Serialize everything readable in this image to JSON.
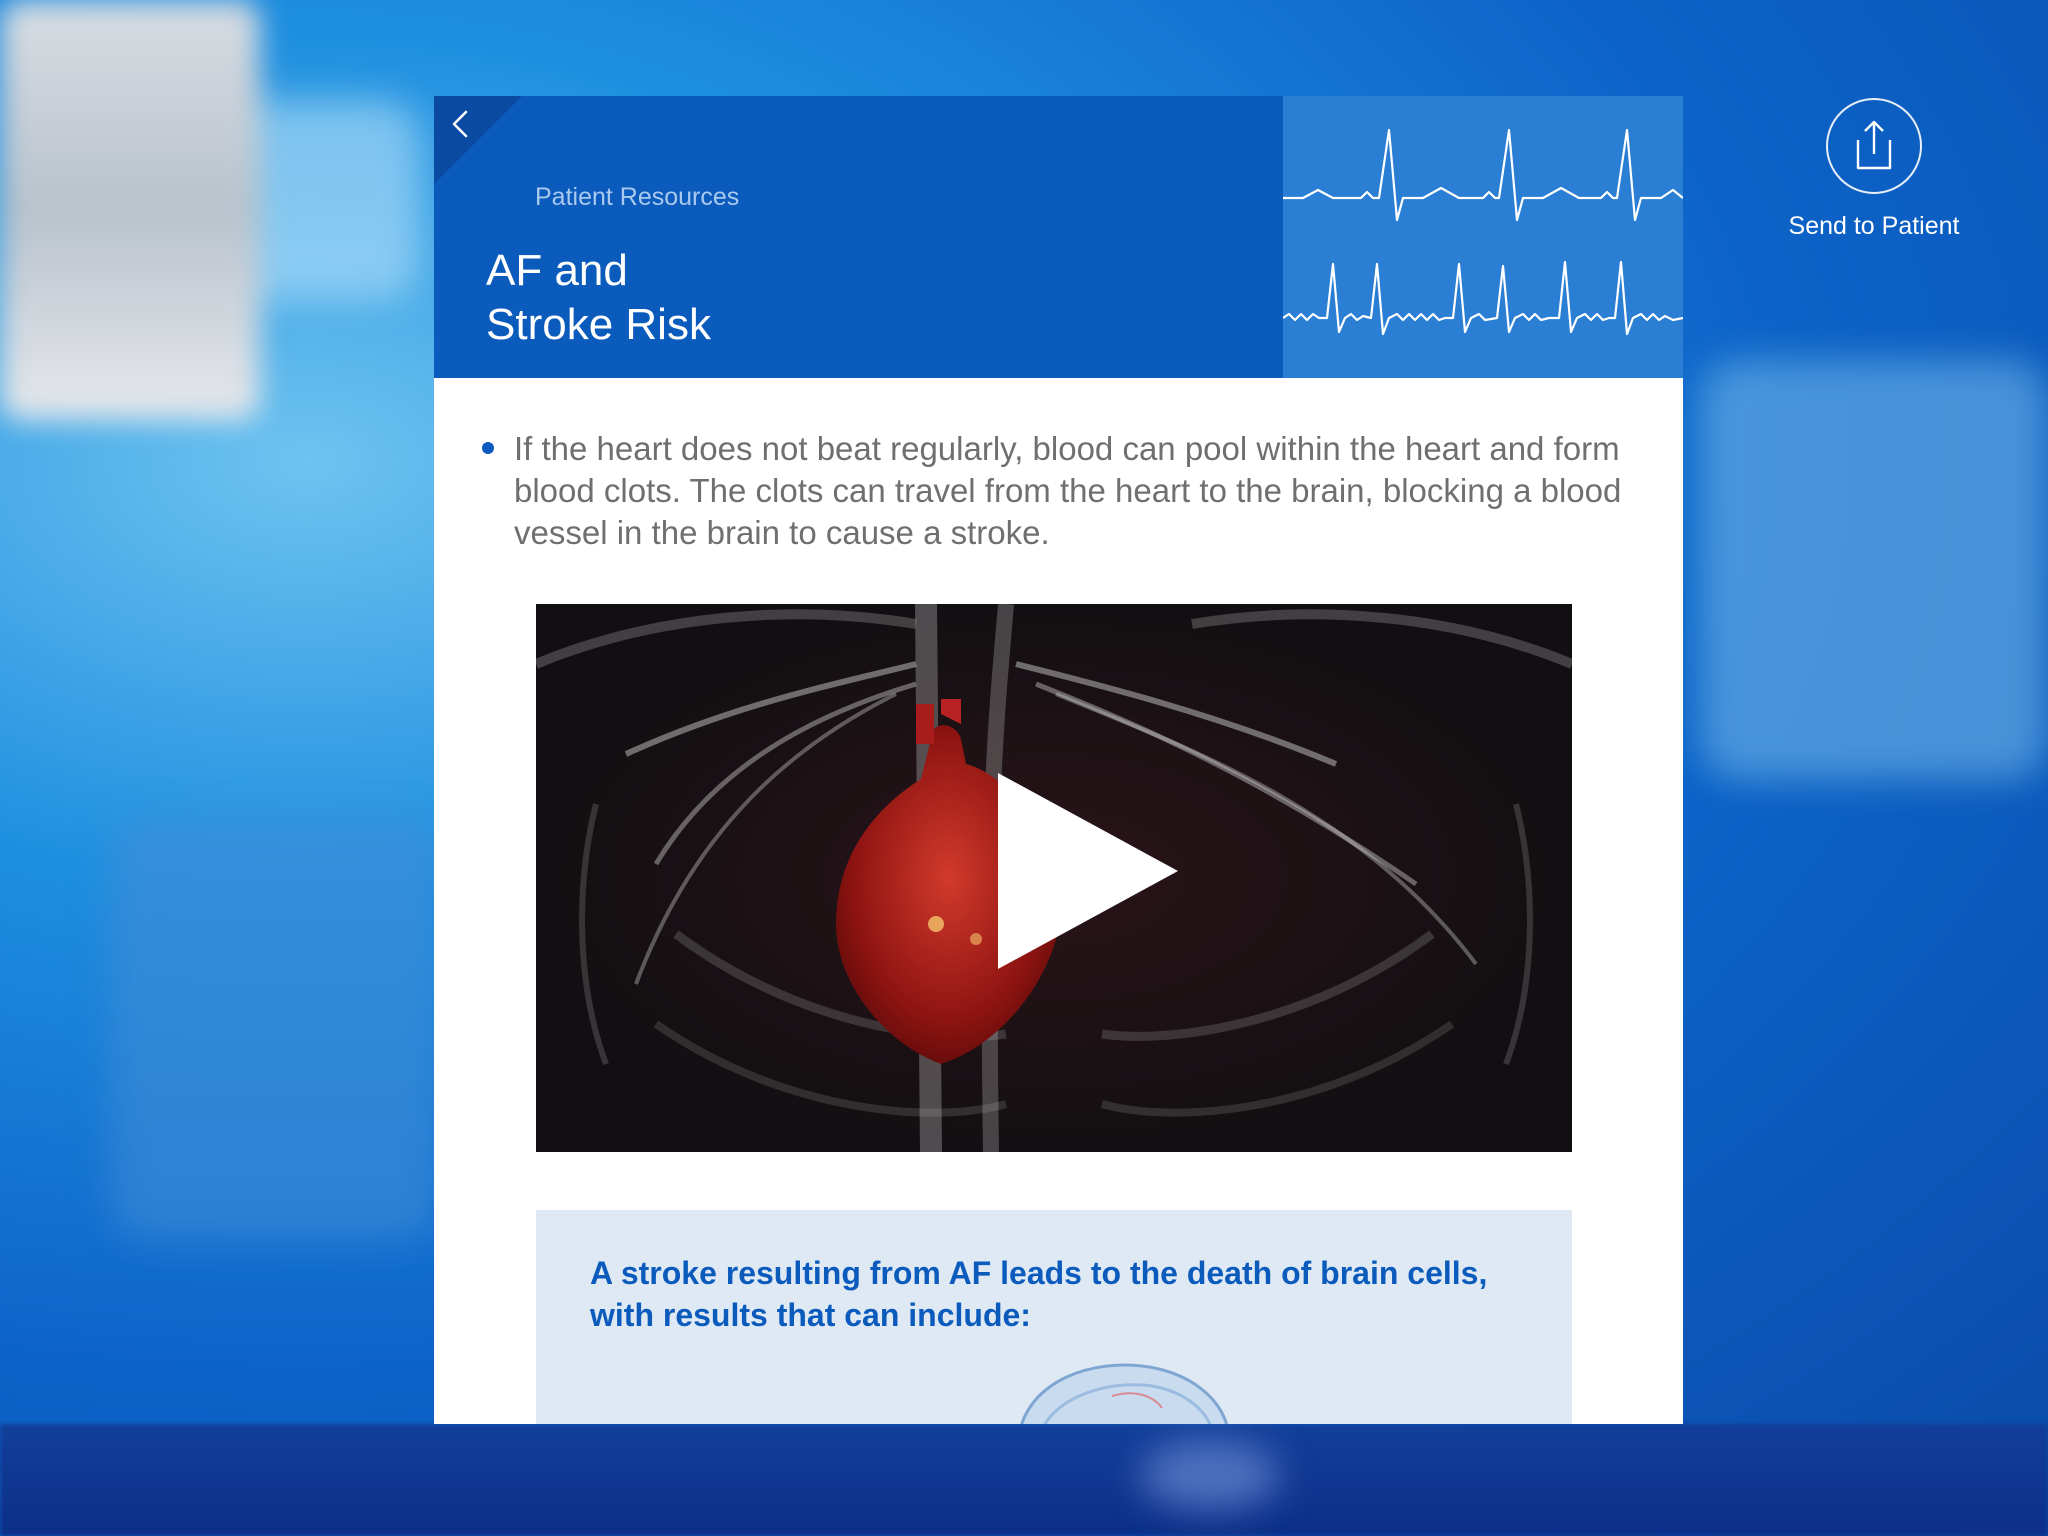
{
  "header": {
    "breadcrumb": "Patient Resources",
    "title_line1": "AF and",
    "title_line2": "Stroke Risk"
  },
  "content": {
    "bullet_text": "If the heart does not beat regularly, blood can pool within the heart and form blood clots. The clots can travel from the heart to the brain, blocking a blood vessel in the brain to cause a stroke.",
    "callout_text": "A stroke resulting from AF leads to the death of brain cells, with results that can include:"
  },
  "actions": {
    "send_label": "Send to Patient"
  },
  "icons": {
    "back": "chevron-left-icon",
    "share": "share-icon",
    "play": "play-icon"
  },
  "colors": {
    "primary_blue": "#0b5bbd",
    "ecg_panel": "#2a7fd4",
    "callout_bg": "#dfe9f4",
    "body_text": "#6f6f6f"
  }
}
